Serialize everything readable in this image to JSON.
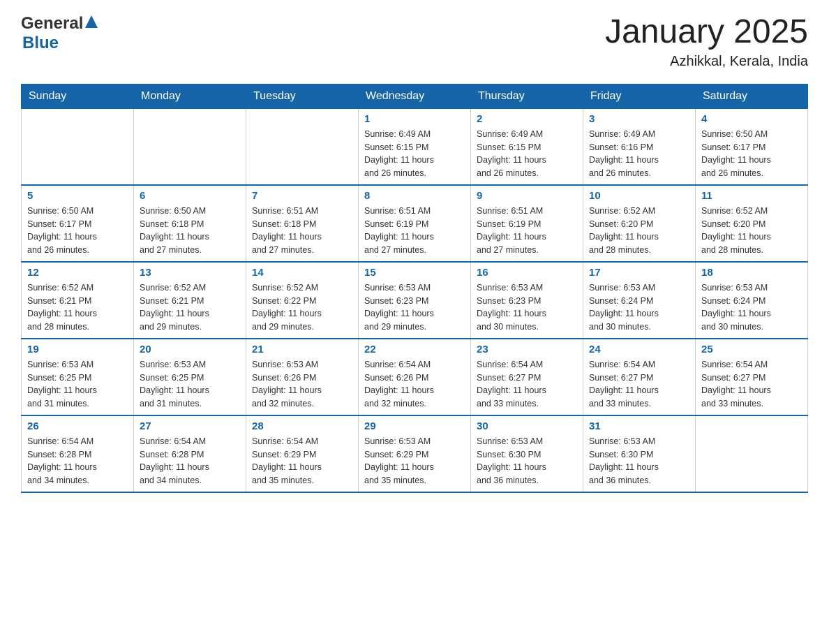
{
  "header": {
    "logo_general": "General",
    "logo_blue": "Blue",
    "title": "January 2025",
    "subtitle": "Azhikkal, Kerala, India"
  },
  "calendar": {
    "days_of_week": [
      "Sunday",
      "Monday",
      "Tuesday",
      "Wednesday",
      "Thursday",
      "Friday",
      "Saturday"
    ],
    "weeks": [
      [
        {
          "day": "",
          "info": ""
        },
        {
          "day": "",
          "info": ""
        },
        {
          "day": "",
          "info": ""
        },
        {
          "day": "1",
          "info": "Sunrise: 6:49 AM\nSunset: 6:15 PM\nDaylight: 11 hours\nand 26 minutes."
        },
        {
          "day": "2",
          "info": "Sunrise: 6:49 AM\nSunset: 6:15 PM\nDaylight: 11 hours\nand 26 minutes."
        },
        {
          "day": "3",
          "info": "Sunrise: 6:49 AM\nSunset: 6:16 PM\nDaylight: 11 hours\nand 26 minutes."
        },
        {
          "day": "4",
          "info": "Sunrise: 6:50 AM\nSunset: 6:17 PM\nDaylight: 11 hours\nand 26 minutes."
        }
      ],
      [
        {
          "day": "5",
          "info": "Sunrise: 6:50 AM\nSunset: 6:17 PM\nDaylight: 11 hours\nand 26 minutes."
        },
        {
          "day": "6",
          "info": "Sunrise: 6:50 AM\nSunset: 6:18 PM\nDaylight: 11 hours\nand 27 minutes."
        },
        {
          "day": "7",
          "info": "Sunrise: 6:51 AM\nSunset: 6:18 PM\nDaylight: 11 hours\nand 27 minutes."
        },
        {
          "day": "8",
          "info": "Sunrise: 6:51 AM\nSunset: 6:19 PM\nDaylight: 11 hours\nand 27 minutes."
        },
        {
          "day": "9",
          "info": "Sunrise: 6:51 AM\nSunset: 6:19 PM\nDaylight: 11 hours\nand 27 minutes."
        },
        {
          "day": "10",
          "info": "Sunrise: 6:52 AM\nSunset: 6:20 PM\nDaylight: 11 hours\nand 28 minutes."
        },
        {
          "day": "11",
          "info": "Sunrise: 6:52 AM\nSunset: 6:20 PM\nDaylight: 11 hours\nand 28 minutes."
        }
      ],
      [
        {
          "day": "12",
          "info": "Sunrise: 6:52 AM\nSunset: 6:21 PM\nDaylight: 11 hours\nand 28 minutes."
        },
        {
          "day": "13",
          "info": "Sunrise: 6:52 AM\nSunset: 6:21 PM\nDaylight: 11 hours\nand 29 minutes."
        },
        {
          "day": "14",
          "info": "Sunrise: 6:52 AM\nSunset: 6:22 PM\nDaylight: 11 hours\nand 29 minutes."
        },
        {
          "day": "15",
          "info": "Sunrise: 6:53 AM\nSunset: 6:23 PM\nDaylight: 11 hours\nand 29 minutes."
        },
        {
          "day": "16",
          "info": "Sunrise: 6:53 AM\nSunset: 6:23 PM\nDaylight: 11 hours\nand 30 minutes."
        },
        {
          "day": "17",
          "info": "Sunrise: 6:53 AM\nSunset: 6:24 PM\nDaylight: 11 hours\nand 30 minutes."
        },
        {
          "day": "18",
          "info": "Sunrise: 6:53 AM\nSunset: 6:24 PM\nDaylight: 11 hours\nand 30 minutes."
        }
      ],
      [
        {
          "day": "19",
          "info": "Sunrise: 6:53 AM\nSunset: 6:25 PM\nDaylight: 11 hours\nand 31 minutes."
        },
        {
          "day": "20",
          "info": "Sunrise: 6:53 AM\nSunset: 6:25 PM\nDaylight: 11 hours\nand 31 minutes."
        },
        {
          "day": "21",
          "info": "Sunrise: 6:53 AM\nSunset: 6:26 PM\nDaylight: 11 hours\nand 32 minutes."
        },
        {
          "day": "22",
          "info": "Sunrise: 6:54 AM\nSunset: 6:26 PM\nDaylight: 11 hours\nand 32 minutes."
        },
        {
          "day": "23",
          "info": "Sunrise: 6:54 AM\nSunset: 6:27 PM\nDaylight: 11 hours\nand 33 minutes."
        },
        {
          "day": "24",
          "info": "Sunrise: 6:54 AM\nSunset: 6:27 PM\nDaylight: 11 hours\nand 33 minutes."
        },
        {
          "day": "25",
          "info": "Sunrise: 6:54 AM\nSunset: 6:27 PM\nDaylight: 11 hours\nand 33 minutes."
        }
      ],
      [
        {
          "day": "26",
          "info": "Sunrise: 6:54 AM\nSunset: 6:28 PM\nDaylight: 11 hours\nand 34 minutes."
        },
        {
          "day": "27",
          "info": "Sunrise: 6:54 AM\nSunset: 6:28 PM\nDaylight: 11 hours\nand 34 minutes."
        },
        {
          "day": "28",
          "info": "Sunrise: 6:54 AM\nSunset: 6:29 PM\nDaylight: 11 hours\nand 35 minutes."
        },
        {
          "day": "29",
          "info": "Sunrise: 6:53 AM\nSunset: 6:29 PM\nDaylight: 11 hours\nand 35 minutes."
        },
        {
          "day": "30",
          "info": "Sunrise: 6:53 AM\nSunset: 6:30 PM\nDaylight: 11 hours\nand 36 minutes."
        },
        {
          "day": "31",
          "info": "Sunrise: 6:53 AM\nSunset: 6:30 PM\nDaylight: 11 hours\nand 36 minutes."
        },
        {
          "day": "",
          "info": ""
        }
      ]
    ]
  }
}
